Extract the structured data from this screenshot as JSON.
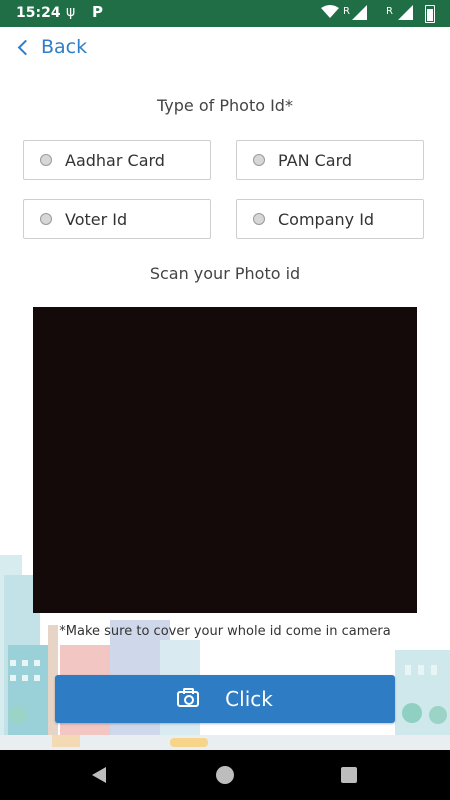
{
  "status_bar": {
    "time": "15:24",
    "roaming_1": "R",
    "roaming_2": "R",
    "icons": [
      "usb-icon",
      "parking-app-icon",
      "wifi-icon",
      "signal-icon",
      "signal-icon",
      "battery-icon"
    ]
  },
  "header": {
    "back_label": "Back"
  },
  "photo_id": {
    "title": "Type of Photo Id*",
    "options": [
      "Aadhar Card",
      "PAN Card",
      "Voter Id",
      "Company Id"
    ]
  },
  "scan": {
    "title": "Scan your Photo id",
    "note": "*Make sure to cover your whole id come in camera"
  },
  "click_button": {
    "label": "Click",
    "icon": "camera-icon"
  },
  "colors": {
    "status_bar": "#1f6e45",
    "accent": "#2e7dc4",
    "camera_preview": "#150a0a"
  }
}
